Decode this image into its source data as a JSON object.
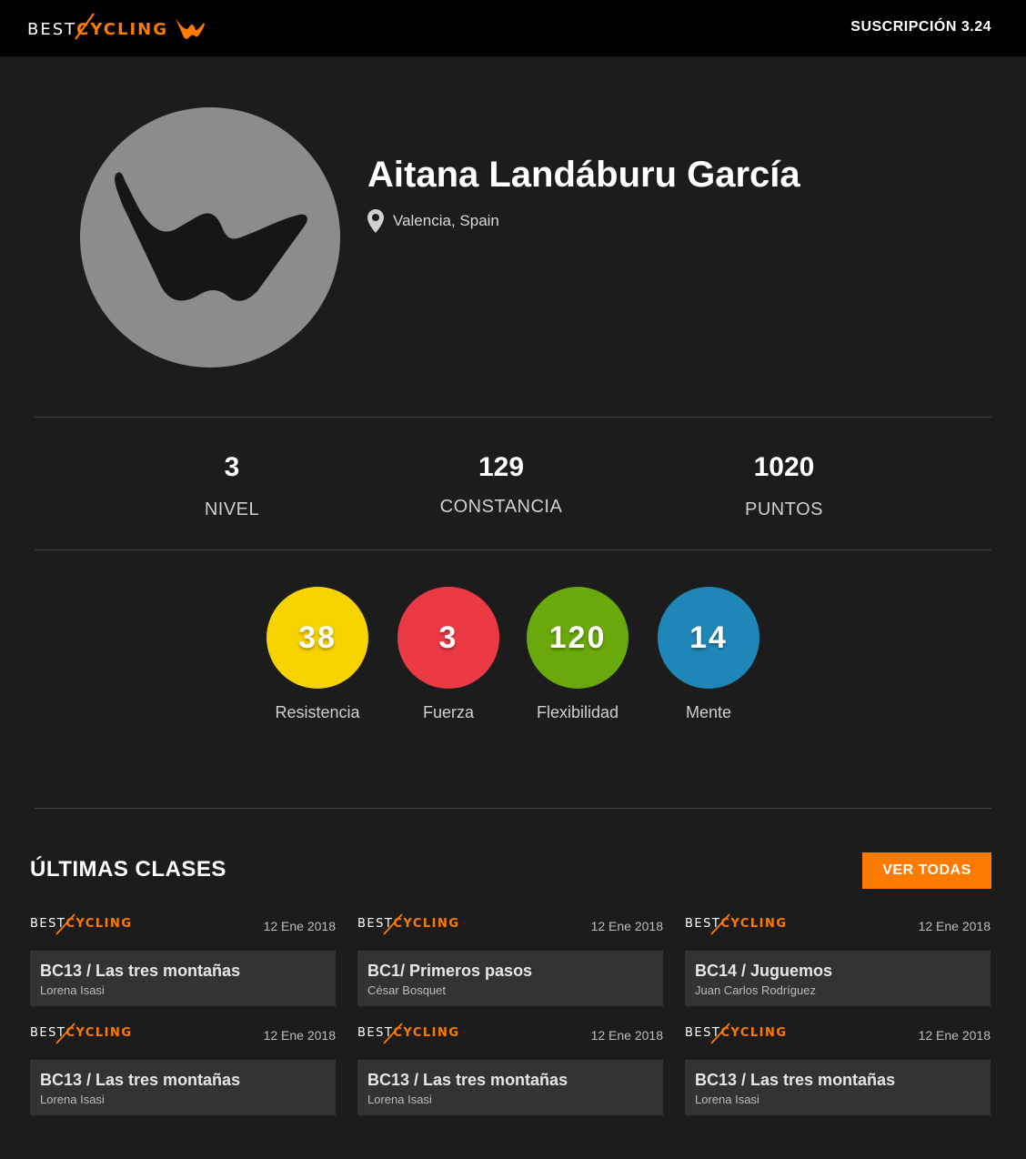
{
  "header": {
    "brand_best": "BEST",
    "brand_cycling": "CYCLING",
    "subscription": "SUSCRIPCIÓN 3.24"
  },
  "profile": {
    "name": "Aitana Landáburu García",
    "location": "Valencia, Spain"
  },
  "stats": [
    {
      "value": "3",
      "label": "NIVEL"
    },
    {
      "value": "129",
      "label": "CONSTANCIA"
    },
    {
      "value": "1020",
      "label": "PUNTOS"
    }
  ],
  "attributes": [
    {
      "value": "38",
      "label": "Resistencia",
      "color": "#f7d300"
    },
    {
      "value": "3",
      "label": "Fuerza",
      "color": "#eb3a44"
    },
    {
      "value": "120",
      "label": "Flexibilidad",
      "color": "#6aa90b"
    },
    {
      "value": "14",
      "label": "Mente",
      "color": "#1f87b8"
    }
  ],
  "classes_section": {
    "title": "ÚLTIMAS CLASES",
    "see_all": "VER TODAS"
  },
  "classes": [
    {
      "date": "12 Ene 2018",
      "title": "BC13 / Las tres montañas",
      "instructor": "Lorena Isasi"
    },
    {
      "date": "12 Ene 2018",
      "title": "BC1/ Primeros pasos",
      "instructor": "César Bosquet"
    },
    {
      "date": "12 Ene 2018",
      "title": "BC14 / Juguemos",
      "instructor": "Juan Carlos Rodríguez"
    },
    {
      "date": "12 Ene 2018",
      "title": "BC13 / Las tres montañas",
      "instructor": "Lorena Isasi"
    },
    {
      "date": "12 Ene 2018",
      "title": "BC13 / Las tres montañas",
      "instructor": "Lorena Isasi"
    },
    {
      "date": "12 Ene 2018",
      "title": "BC13 / Las tres montañas",
      "instructor": "Lorena Isasi"
    }
  ],
  "colors": {
    "accent": "#ff7a00",
    "background": "#1c1c1c",
    "topbar": "#000000",
    "card": "#333333"
  },
  "icons": {
    "logo": "bestcycling-w-logo",
    "avatar": "bestcycling-w-avatar",
    "location": "map-pin-icon"
  }
}
